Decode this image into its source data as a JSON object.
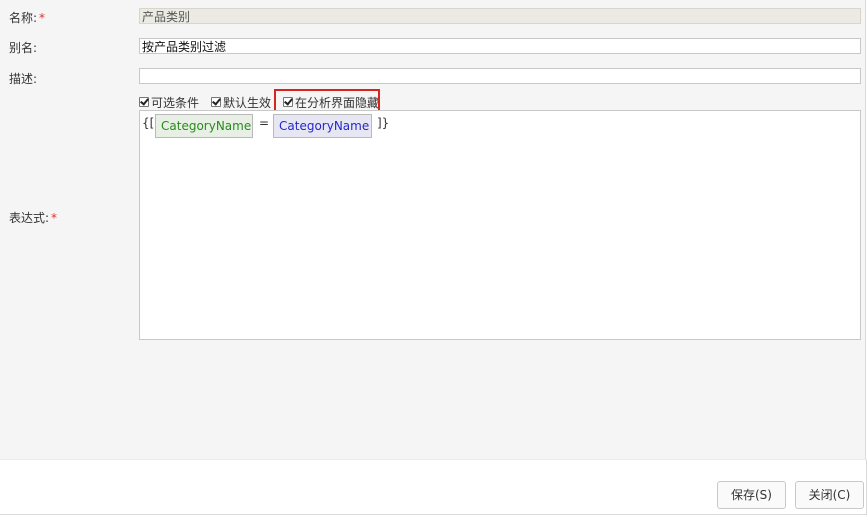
{
  "form": {
    "name_label": "名称:",
    "name_value": "产品类别",
    "alias_label": "别名:",
    "alias_value": "按产品类别过滤",
    "desc_label": "描述:",
    "desc_value": "",
    "expr_label": "表达式:",
    "required_mark": "*"
  },
  "options": [
    {
      "label": "可选条件",
      "checked": true
    },
    {
      "label": "默认生效",
      "checked": true
    },
    {
      "label": "在分析界面隐藏",
      "checked": true,
      "highlighted": true
    }
  ],
  "highlight_color": "#d9231f",
  "expression": {
    "open": "{[",
    "field": "CategoryName",
    "operator": "=",
    "value": "CategoryName",
    "close": "]}",
    "field_color": "#2a8a1f",
    "value_color": "#2727c9"
  },
  "buttons": {
    "save": "保存(S)",
    "close": "关闭(C)"
  }
}
